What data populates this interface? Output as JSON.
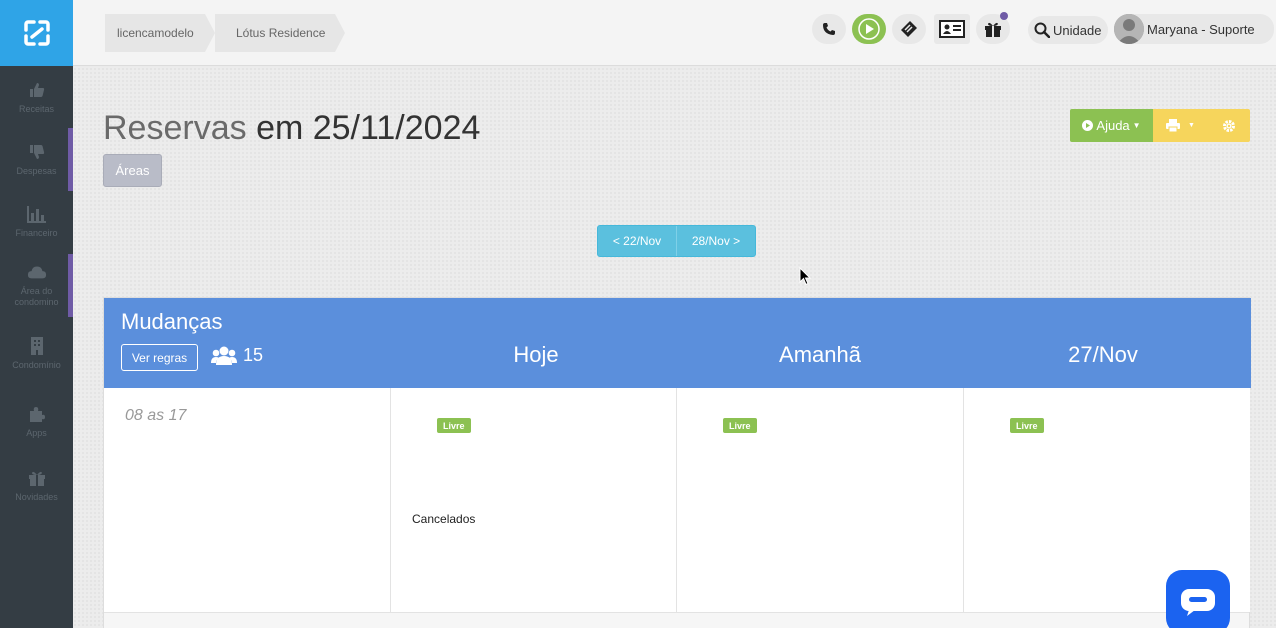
{
  "sidebar": {
    "items": [
      {
        "label": "Receitas",
        "icon": "thumbs-up-icon"
      },
      {
        "label": "Despesas",
        "icon": "thumbs-down-icon"
      },
      {
        "label": "Financeiro",
        "icon": "bar-chart-icon"
      },
      {
        "label": "Área do condomino",
        "icon": "cloud-icon"
      },
      {
        "label": "Condomínio",
        "icon": "building-icon"
      },
      {
        "label": "Apps",
        "icon": "puzzle-icon"
      },
      {
        "label": "Novidades",
        "icon": "gift-icon"
      }
    ]
  },
  "breadcrumb": [
    "licencamodelo",
    "Lótus Residence"
  ],
  "header": {
    "search_label": "Unidade",
    "user_name": "Maryana - Suporte"
  },
  "page": {
    "title_part1": "Reservas",
    "title_part2": "em 25/11/2024",
    "areas_label": "Áreas",
    "help_label": "Ajuda"
  },
  "date_nav": {
    "prev_label": "< 22/Nov",
    "next_label": "28/Nov >"
  },
  "schedule": {
    "area_name": "Mudanças",
    "rules_label": "Ver regras",
    "capacity": "15",
    "days": [
      "Hoje",
      "Amanhã",
      "27/Nov"
    ],
    "time_slot": "08 as 17",
    "statuses": [
      "Livre",
      "Livre",
      "Livre"
    ],
    "cancelled_label": "Cancelados"
  },
  "colors": {
    "sidebar_bg": "#343d44",
    "brand_blue": "#2fa4e7",
    "panel_header": "#5b8fdc",
    "success_green": "#8cc152",
    "warning_yellow": "#f6d55c",
    "info_cyan": "#5bc0de",
    "chat_blue": "#1b63f0"
  }
}
